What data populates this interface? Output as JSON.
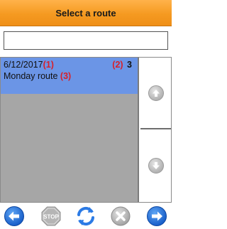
{
  "header": {
    "title": "Select a route"
  },
  "search": {
    "value": ""
  },
  "routes": [
    {
      "date": "6/12/2017",
      "date_marker": "(1)",
      "count_marker": "(2)",
      "count": "3",
      "name": "Monday route",
      "name_marker": "(3)",
      "selected": true
    }
  ],
  "scroll": {
    "up_icon": "arrow-up-icon",
    "down_icon": "arrow-down-icon"
  },
  "toolbar": {
    "back_icon": "arrow-left-icon",
    "stop_label": "STOP",
    "refresh_icon": "refresh-icon",
    "cancel_icon": "close-icon",
    "next_icon": "arrow-right-icon"
  },
  "colors": {
    "header_orange": "#f59a21",
    "selection_blue": "#6b95e6",
    "list_gray": "#a6a6a6",
    "marker_red": "#d8202a",
    "action_blue": "#1f6fd6"
  }
}
